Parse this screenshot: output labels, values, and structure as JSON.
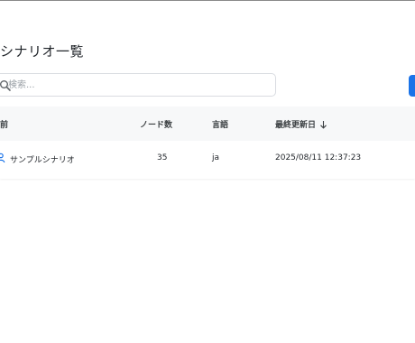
{
  "page": {
    "title": "シナリオ一覧"
  },
  "search": {
    "placeholder": "検索..."
  },
  "table": {
    "columns": {
      "name": "前",
      "nodes": "ノード数",
      "language": "言語",
      "updated": "最終更新日"
    },
    "sort": {
      "column": "updated",
      "direction": "descending"
    },
    "rows": [
      {
        "name": "サンプルシナリオ",
        "nodes": "35",
        "language": "ja",
        "updated": "2025/08/11 12:37:23"
      }
    ]
  },
  "colors": {
    "accent": "#1a73e8",
    "header_bg": "#f7f8f9",
    "border": "#d9dce1"
  },
  "icons": {
    "search": "search-icon",
    "sort": "arrow-down-icon",
    "row": "scenario-icon"
  }
}
